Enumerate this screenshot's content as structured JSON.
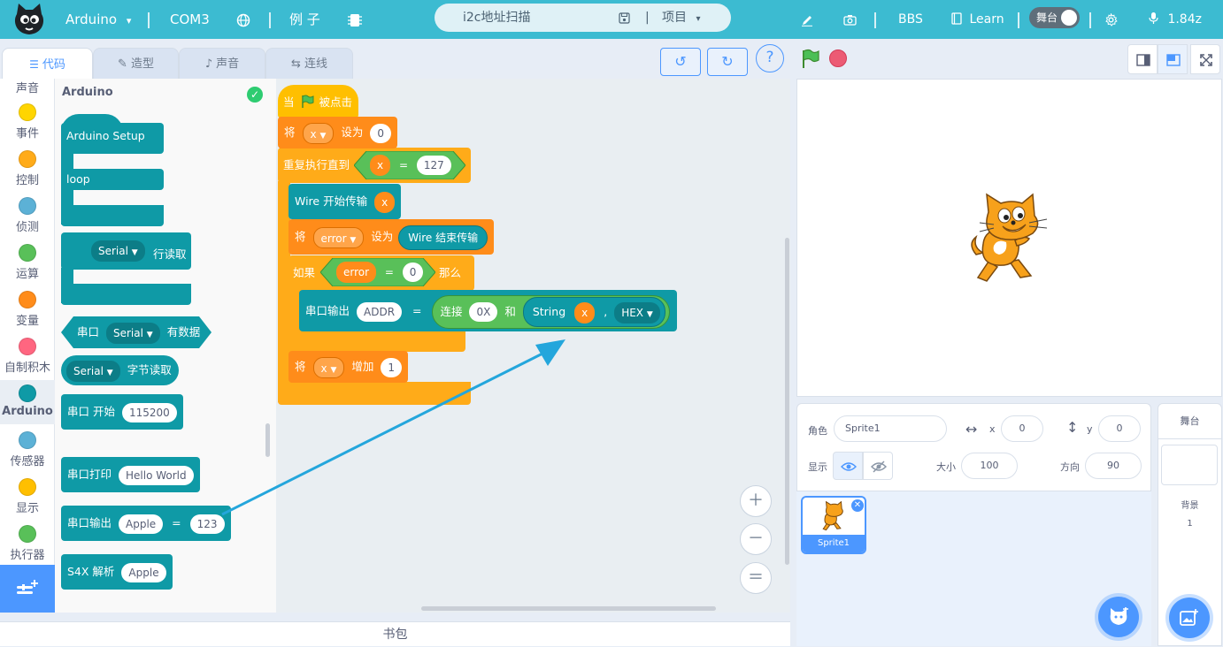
{
  "topbar": {
    "board": "Arduino",
    "port": "COM3",
    "examples": "例 子",
    "project_name": "i2c地址扫描",
    "project_menu": "项目",
    "bbs": "BBS",
    "learn": "Learn",
    "stage_toggle": "舞台",
    "version": "1.84z"
  },
  "tabs": {
    "code": "代码",
    "costume": "造型",
    "sound": "声音",
    "wiring": "连线"
  },
  "categories": [
    "声音",
    "事件",
    "控制",
    "侦测",
    "运算",
    "变量",
    "自制积木",
    "Arduino",
    "传感器",
    "显示",
    "执行器"
  ],
  "category_colors": [
    "#ffd500",
    "#ffab19",
    "#5cb1d6",
    "#59c059",
    "#ff8c1a",
    "#ff6680",
    "#0f9aa6",
    "#5cb1d6",
    "#ffbf00",
    "#59c059"
  ],
  "palette": {
    "title": "Arduino",
    "setup": "Arduino Setup",
    "loop": "loop",
    "serial_read_line_port": "Serial",
    "serial_read_line": "行读取",
    "serial_available_prefix": "串口",
    "serial_available_port": "Serial",
    "serial_available_suffix": "有数据",
    "serial_read_byte_port": "Serial",
    "serial_read_byte": "字节读取",
    "serial_begin": "串口 开始",
    "serial_begin_baud": "115200",
    "serial_print": "串口打印",
    "serial_print_value": "Hello World",
    "serial_output": "串口输出",
    "serial_output_key": "Apple",
    "serial_output_eq": "=",
    "serial_output_value": "123",
    "s4x_parse": "S4X 解析",
    "s4x_value": "Apple"
  },
  "script": {
    "when": "当",
    "clicked": "被点击",
    "set1_prefix": "将",
    "set1_var": "x",
    "set1_to": "设为",
    "set1_value": "0",
    "repeat_until": "重复执行直到",
    "cond_var": "x",
    "cond_eq": "=",
    "cond_value": "127",
    "wire_begin": "Wire 开始传输",
    "wire_begin_arg": "x",
    "set2_prefix": "将",
    "set2_var": "error",
    "set2_to": "设为",
    "wire_end": "Wire 结束传输",
    "if": "如果",
    "if_var": "error",
    "if_eq": "=",
    "if_value": "0",
    "then": "那么",
    "output": "串口输出",
    "output_key": "ADDR",
    "output_eq": "=",
    "concat": "连接",
    "concat_a": "0X",
    "concat_and": "和",
    "string": "String",
    "string_arg": "x",
    "comma": ",",
    "format": "HEX",
    "change_prefix": "将",
    "change_var": "x",
    "change_by": "增加",
    "change_value": "1"
  },
  "sprite": {
    "label_sprite": "角色",
    "name": "Sprite1",
    "label_x": "x",
    "x": "0",
    "label_y": "y",
    "y": "0",
    "label_show": "显示",
    "label_size": "大小",
    "size": "100",
    "label_direction": "方向",
    "direction": "90",
    "thumb_name": "Sprite1"
  },
  "stage_pane": {
    "title": "舞台",
    "backdrops_label": "背景",
    "backdrops_count": "1"
  },
  "backpack": "书包"
}
